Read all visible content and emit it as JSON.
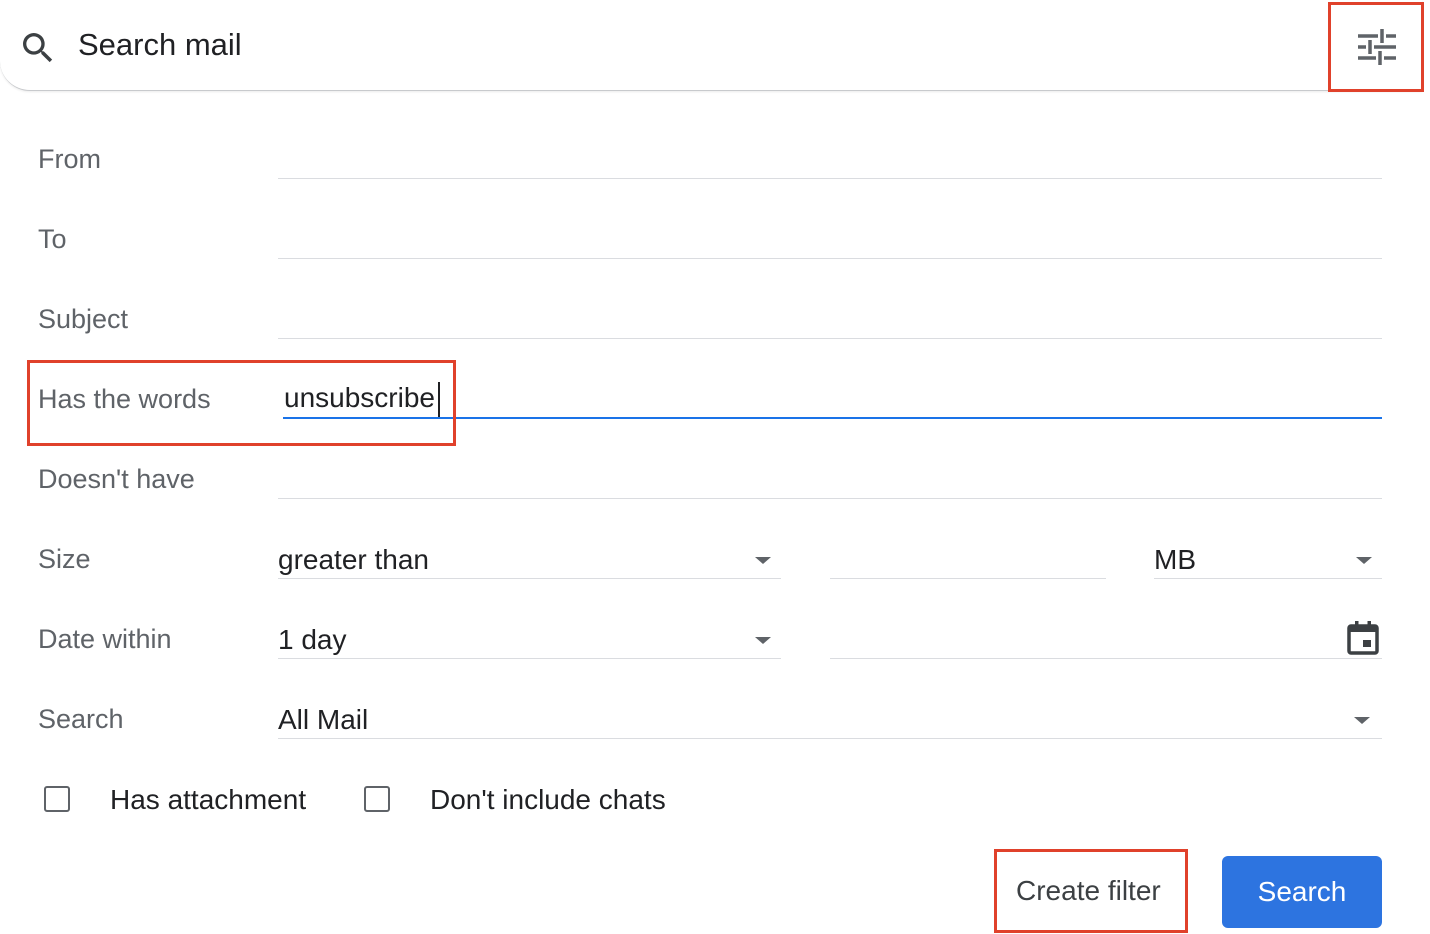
{
  "search_bar": {
    "placeholder": "Search mail",
    "icon": "search-icon",
    "options_icon": "tune-icon"
  },
  "fields": {
    "from": {
      "label": "From",
      "value": ""
    },
    "to": {
      "label": "To",
      "value": ""
    },
    "subject": {
      "label": "Subject",
      "value": ""
    },
    "has_words": {
      "label": "Has the words",
      "value": "unsubscribe"
    },
    "doesnt_have": {
      "label": "Doesn't have",
      "value": ""
    }
  },
  "size": {
    "label": "Size",
    "comparator": "greater than",
    "amount": "",
    "unit": "MB"
  },
  "date_within": {
    "label": "Date within",
    "range": "1 day",
    "date": "",
    "icon": "calendar-icon"
  },
  "search_scope": {
    "label": "Search",
    "value": "All Mail"
  },
  "checkboxes": {
    "has_attachment": {
      "label": "Has attachment",
      "checked": false
    },
    "no_chats": {
      "label": "Don't include chats",
      "checked": false
    }
  },
  "buttons": {
    "create_filter": "Create filter",
    "search": "Search"
  },
  "colors": {
    "accent": "#1a73e8",
    "search_button": "#2d74e0",
    "highlight": "#e0412b"
  }
}
